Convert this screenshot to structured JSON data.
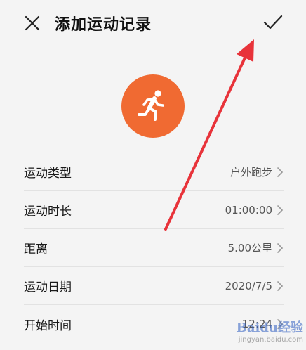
{
  "header": {
    "close_icon": "close-icon",
    "title": "添加运动记录",
    "confirm_icon": "checkmark-icon"
  },
  "activity_icon": {
    "icon": "running-person-icon",
    "color": "#f06a32"
  },
  "fields": [
    {
      "label": "运动类型",
      "value": "户外跑步"
    },
    {
      "label": "运动时长",
      "value": "01:00:00"
    },
    {
      "label": "距离",
      "value": "5.00公里"
    },
    {
      "label": "运动日期",
      "value": "2020/7/5"
    },
    {
      "label": "开始时间",
      "value": "12:24"
    }
  ],
  "annotation": {
    "type": "arrow",
    "color": "#e8333a",
    "points_to": "confirm-button"
  },
  "watermark": {
    "brand": "Baidu经验",
    "url": "jingyan.baidu.com"
  }
}
